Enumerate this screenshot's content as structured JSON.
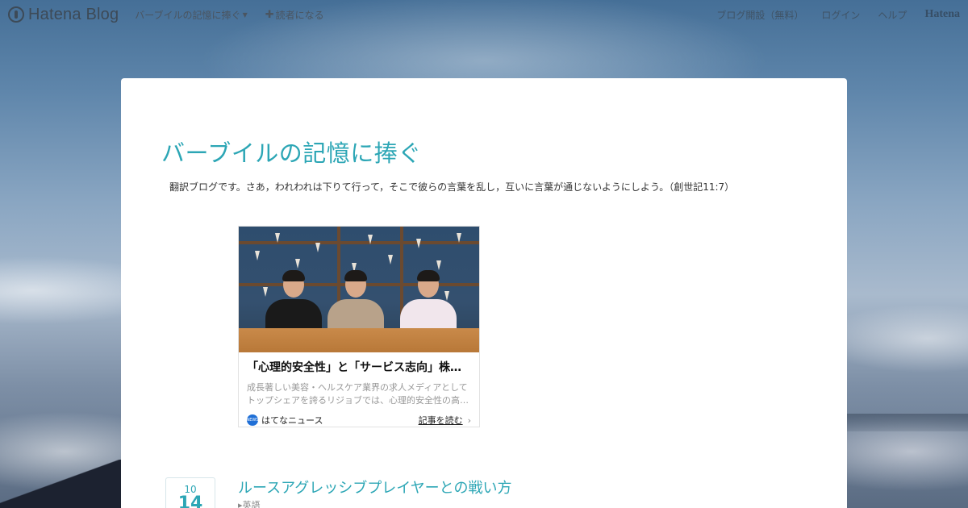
{
  "topbar": {
    "logo_text": "Hatena Blog",
    "blog_menu_label": "バーブイルの記憶に捧ぐ",
    "subscribe_label": "読者になる",
    "start_blog_label": "ブログ開設（無料）",
    "login_label": "ログイン",
    "help_label": "ヘルプ",
    "hatena_label": "Hatena"
  },
  "blog": {
    "title": "バーブイルの記憶に捧ぐ",
    "description": "翻訳ブログです。さあ，われわれは下りて行って，そこで彼らの言葉を乱し，互いに言葉が通じないようにしよう。（創世記11:7）"
  },
  "news_card": {
    "title": "「心理的安全性」と「サービス志向」株…",
    "excerpt": "成長著しい美容・ヘルスケア業界の求人メディアとしてトップシェアを誇るリジョブでは、心理的安全性の高…",
    "source": "はてなニュース",
    "read_more": "記事を読む"
  },
  "entry": {
    "month": "10",
    "day": "14",
    "title": "ルースアグレッシブプレイヤーとの戦い方",
    "category": "英語"
  },
  "colors": {
    "accent": "#2ca6b5",
    "card_bg": "#ffffff"
  }
}
